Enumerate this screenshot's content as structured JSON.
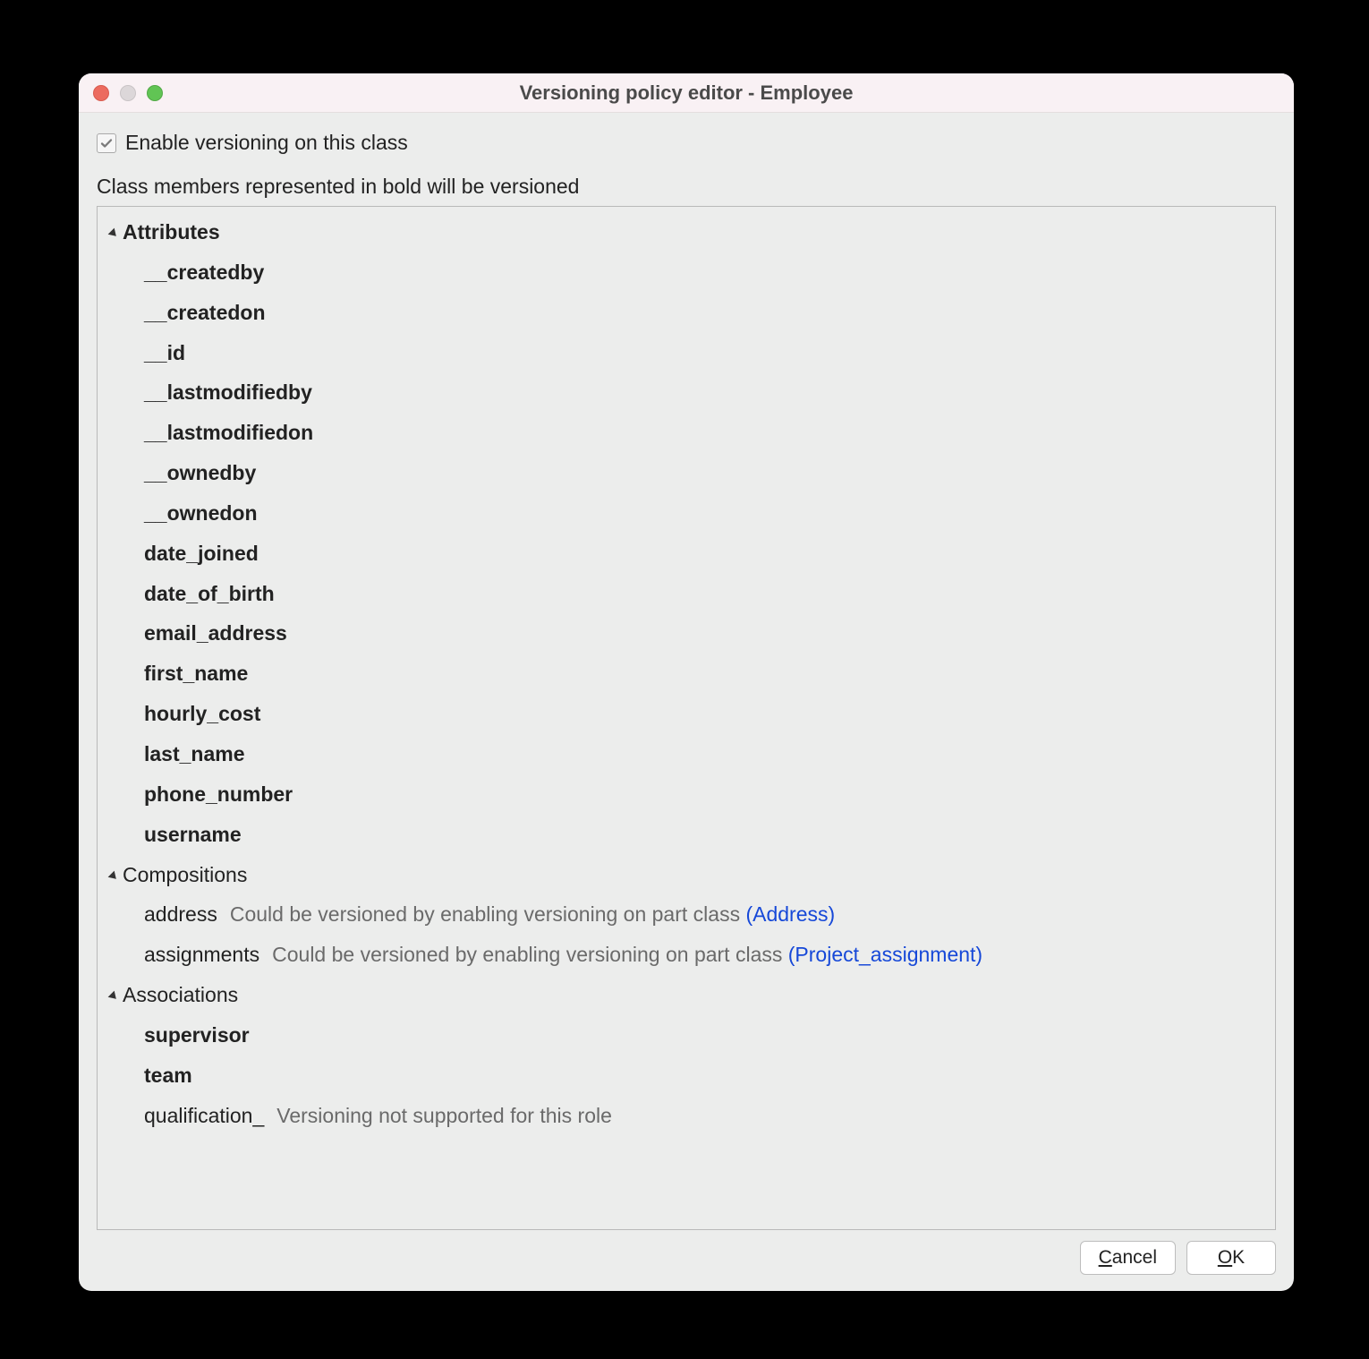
{
  "window": {
    "title": "Versioning policy editor - Employee"
  },
  "enable_checkbox": {
    "checked": true,
    "label": "Enable versioning on this class"
  },
  "hint": "Class members represented in bold will be versioned",
  "sections": {
    "attributes": {
      "label": "Attributes",
      "bold": true,
      "items": [
        {
          "label": "__createdby",
          "bold": true
        },
        {
          "label": "__createdon",
          "bold": true
        },
        {
          "label": "__id",
          "bold": true
        },
        {
          "label": "__lastmodifiedby",
          "bold": true
        },
        {
          "label": "__lastmodifiedon",
          "bold": true
        },
        {
          "label": "__ownedby",
          "bold": true
        },
        {
          "label": "__ownedon",
          "bold": true
        },
        {
          "label": "date_joined",
          "bold": true
        },
        {
          "label": "date_of_birth",
          "bold": true
        },
        {
          "label": "email_address",
          "bold": true
        },
        {
          "label": "first_name",
          "bold": true
        },
        {
          "label": "hourly_cost",
          "bold": true
        },
        {
          "label": "last_name",
          "bold": true
        },
        {
          "label": "phone_number",
          "bold": true
        },
        {
          "label": "username",
          "bold": true
        }
      ]
    },
    "compositions": {
      "label": "Compositions",
      "bold": false,
      "items": [
        {
          "label": "address",
          "bold": false,
          "note_prefix": "Could be versioned by enabling versioning on part class ",
          "link": "(Address)"
        },
        {
          "label": "assignments",
          "bold": false,
          "note_prefix": "Could be versioned by enabling versioning on part class ",
          "link": "(Project_assignment)"
        }
      ]
    },
    "associations": {
      "label": "Associations",
      "bold": false,
      "items": [
        {
          "label": "supervisor",
          "bold": true
        },
        {
          "label": "team",
          "bold": true
        },
        {
          "label": "qualification_",
          "bold": false,
          "note_prefix": "Versioning not supported for this role"
        }
      ]
    }
  },
  "buttons": {
    "cancel": {
      "mnemonic": "C",
      "rest": "ancel"
    },
    "ok": {
      "mnemonic": "O",
      "rest": "K"
    }
  }
}
